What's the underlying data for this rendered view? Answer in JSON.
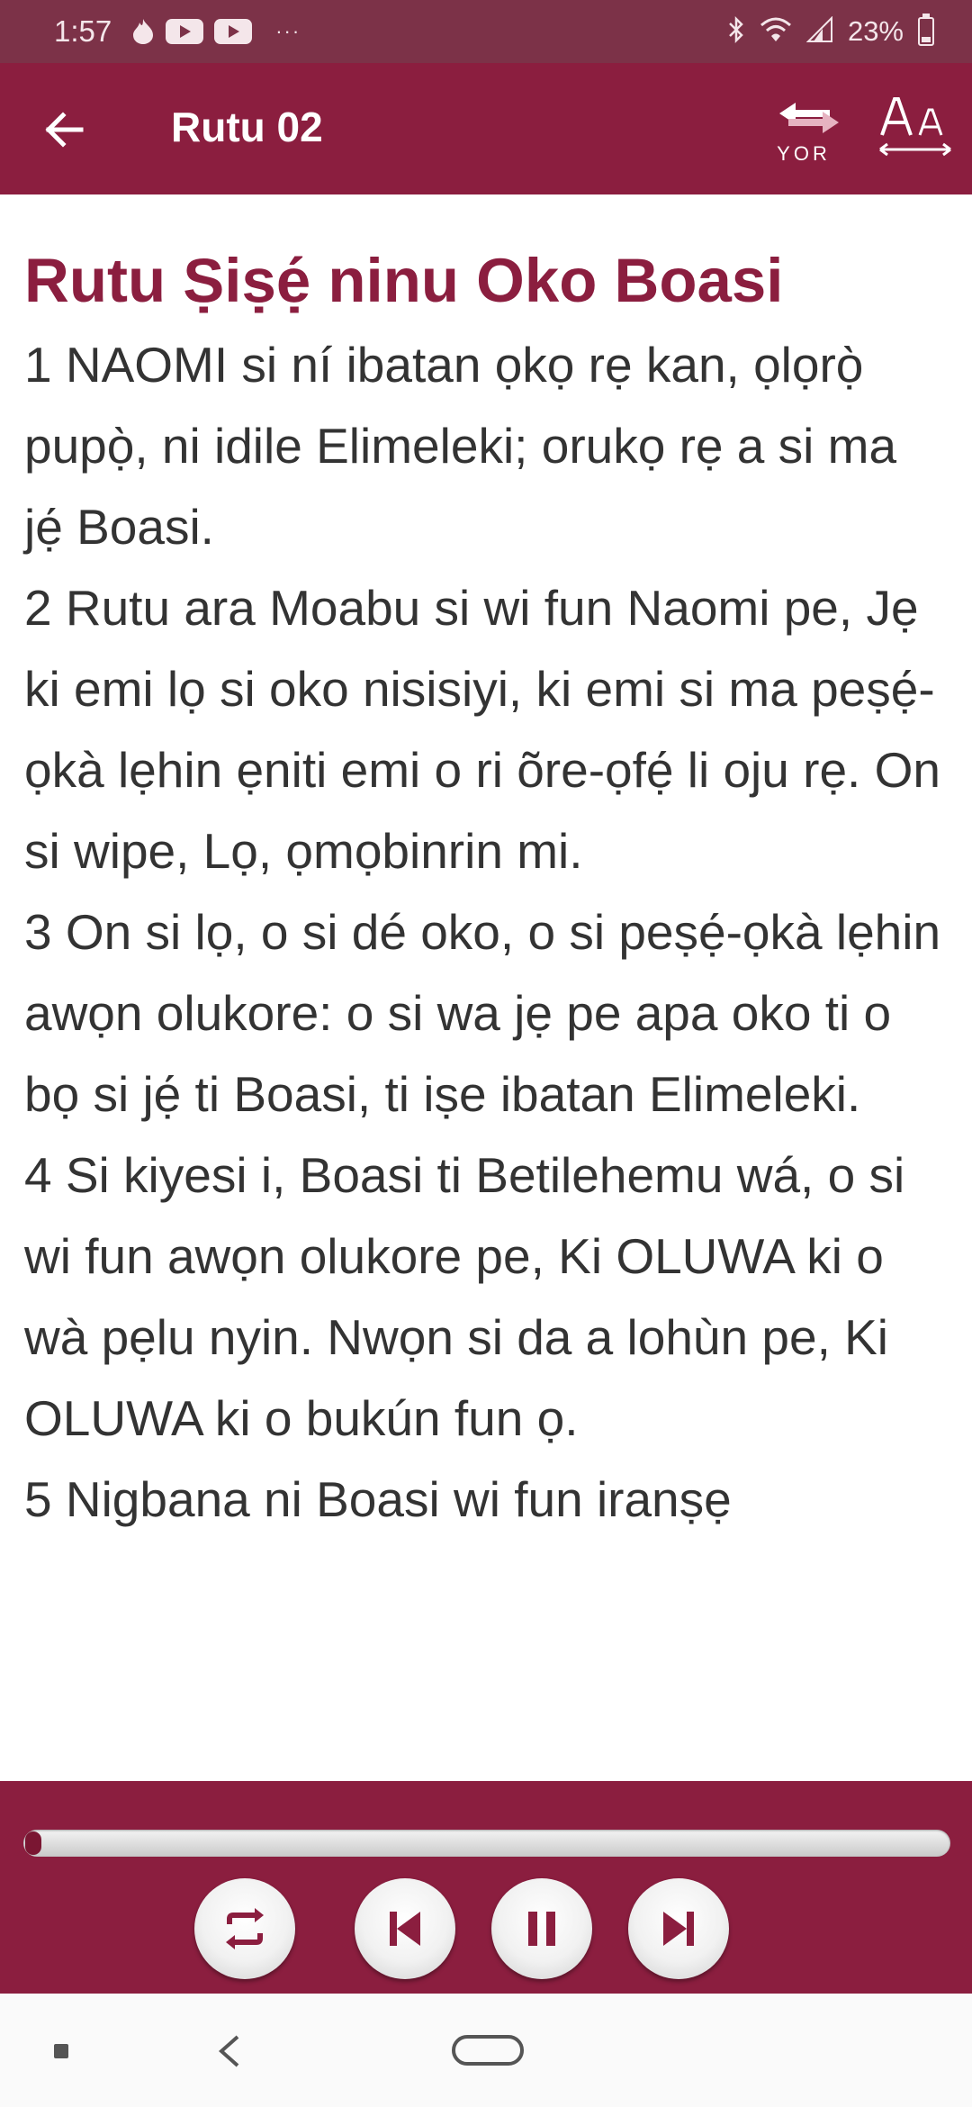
{
  "status_bar": {
    "time": "1:57",
    "battery": "23%",
    "overflow": "···",
    "icons": [
      "flame-icon",
      "youtube-icon",
      "youtube-icon",
      "bluetooth-icon",
      "wifi-icon",
      "signal-icon",
      "battery-icon"
    ]
  },
  "app_bar": {
    "title": "Rutu 02",
    "lang_label": "YOR",
    "back_icon": "arrow-left-icon",
    "lang_icon": "swap-arrows-icon",
    "font_icon": "font-size-icon"
  },
  "content": {
    "heading": "Rutu Ṣiṣẹ́ ninu Oko Boasi",
    "verses": [
      "1 NAOMI si ní ibatan ọkọ rẹ kan, ọlọrọ̀ pupọ̀, ni idile Elimeleki; orukọ rẹ a si ma jẹ́ Boasi.",
      "2 Rutu ara Moabu si wi fun Naomi pe, Jẹ ki emi lọ si oko nisisiyi, ki emi si ma peṣẹ́-ọkà lẹhin ẹniti emi o ri õre-ọfẹ́ li oju rẹ. On si wipe, Lọ, ọmọbinrin mi.",
      "3 On si lọ, o si dé oko, o si peṣẹ́-ọkà lẹhin awọn olukore: o si wa jẹ pe apa oko ti o bọ si jẹ́ ti Boasi, ti iṣe ibatan Elimeleki.",
      "4 Si kiyesi i, Boasi ti Betilehemu wá, o si wi fun awọn olukore pe, Ki OLUWA ki o wà pẹlu nyin. Nwọn si da a lohùn pe, Ki OLUWA ki o bukún fun ọ.",
      "5 Nigbana ni Boasi wi fun iranṣẹ"
    ]
  },
  "player": {
    "progress": 0.012,
    "accent": "#8b1e3f",
    "controls": [
      "repeat-icon",
      "skip-previous-icon",
      "pause-icon",
      "skip-next-icon"
    ]
  },
  "colors": {
    "status_bar": "#7c3248",
    "app_bar": "#8b1e3f",
    "heading": "#8b1e3f",
    "body_text": "#333333"
  },
  "nav_bar": {
    "icons": [
      "recents-icon",
      "back-icon",
      "home-icon"
    ]
  }
}
